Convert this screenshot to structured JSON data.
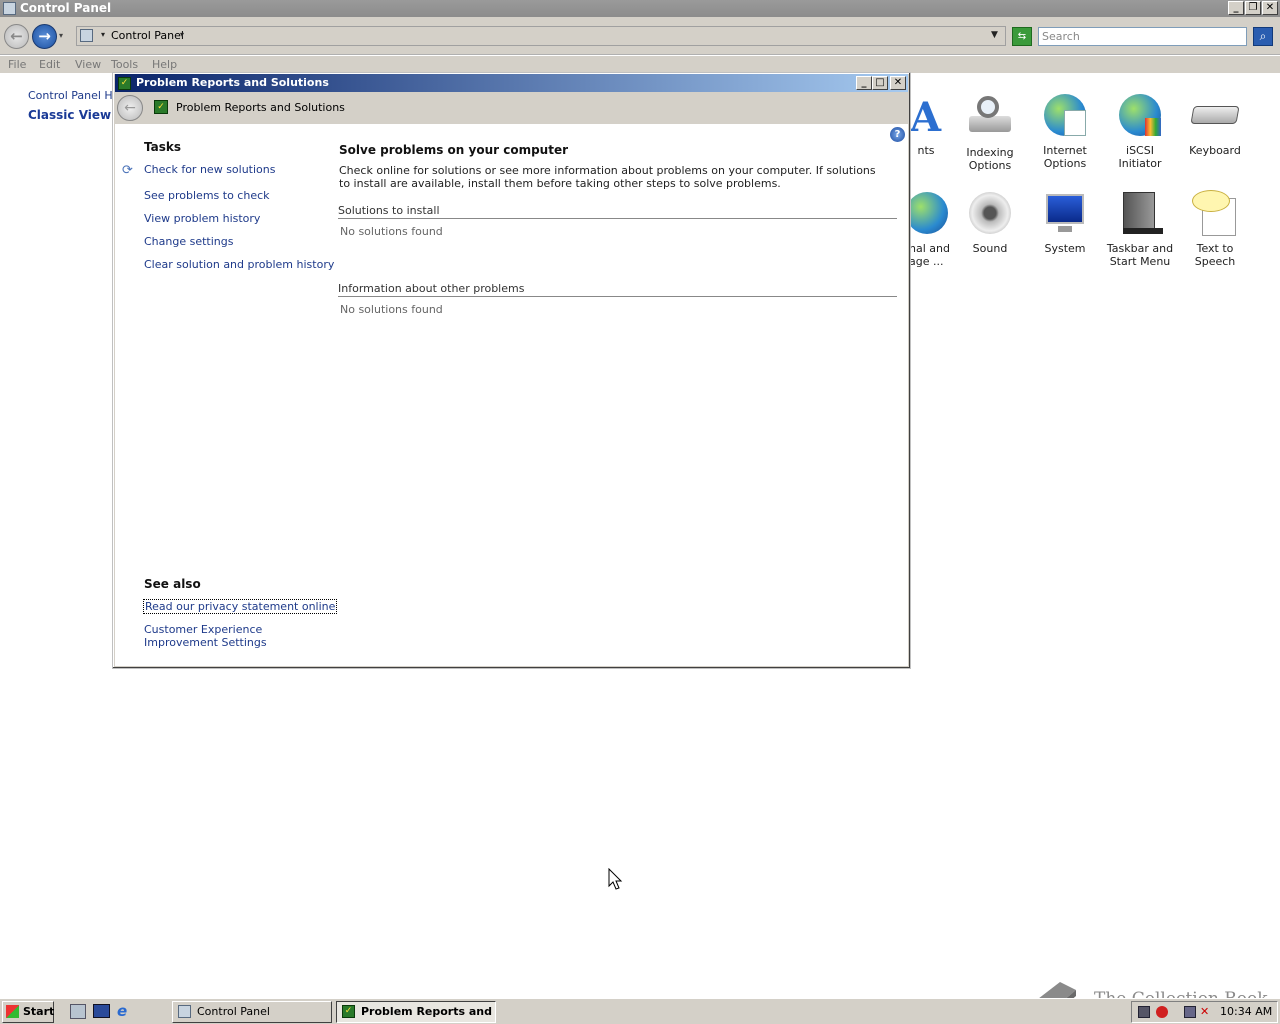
{
  "main_window": {
    "title": "Control Panel",
    "address_segment": "Control Panel",
    "search_placeholder": "Search",
    "menu": [
      "File",
      "Edit",
      "View",
      "Tools",
      "Help"
    ],
    "sidebar": {
      "home_link": "Control Panel Home",
      "classic_view": "Classic View"
    },
    "items": [
      {
        "label": "nts",
        "icon": "fonts-icon"
      },
      {
        "label": "Indexing Options",
        "icon": "indexing-icon"
      },
      {
        "label": "Internet Options",
        "icon": "internet-options-icon"
      },
      {
        "label": "iSCSI Initiator",
        "icon": "iscsi-icon"
      },
      {
        "label": "Keyboard",
        "icon": "keyboard-icon"
      },
      {
        "label": "nal and\nage ...",
        "icon": "regional-icon"
      },
      {
        "label": "Sound",
        "icon": "sound-icon"
      },
      {
        "label": "System",
        "icon": "system-icon"
      },
      {
        "label": "Taskbar and Start Menu",
        "icon": "taskbar-icon"
      },
      {
        "label": "Text to Speech",
        "icon": "speech-icon"
      }
    ]
  },
  "dialog": {
    "title": "Problem Reports and Solutions",
    "nav_title": "Problem Reports and Solutions",
    "tasks_heading": "Tasks",
    "tasks": [
      "Check for new solutions",
      "See problems to check",
      "View problem history",
      "Change settings",
      "Clear solution and problem history"
    ],
    "see_also_heading": "See also",
    "see_also": [
      "Read our privacy statement online",
      "Customer Experience Improvement Settings"
    ],
    "main_heading": "Solve problems on your computer",
    "description": "Check online for solutions or see more information about problems on your computer. If solutions to install are available, install them before taking other steps to solve problems.",
    "section1": {
      "heading": "Solutions to install",
      "empty": "No solutions found"
    },
    "section2": {
      "heading": "Information about other problems",
      "empty": "No solutions found"
    }
  },
  "taskbar": {
    "start": "Start",
    "buttons": [
      "Control Panel",
      "Problem Reports and ..."
    ],
    "clock": "10:34 AM"
  },
  "watermark": "The Collection Book"
}
